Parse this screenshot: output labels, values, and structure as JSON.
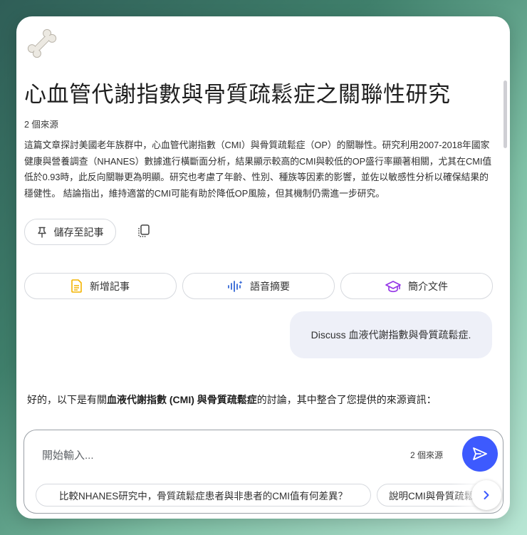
{
  "notebook": {
    "title": "心血管代謝指數與骨質疏鬆症之關聯性研究",
    "source_count": "2 個來源",
    "summary": "這篇文章探討美國老年族群中，心血管代謝指數（CMI）與骨質疏鬆症（OP）的關聯性。研究利用2007-2018年國家健康與營養調查（NHANES）數據進行橫斷面分析，結果顯示較高的CMI與較低的OP盛行率顯著相關，尤其在CMI值低於0.93時，此反向關聯更為明顯。研究也考慮了年齡、性別、種族等因素的影響，並佐以敏感性分析以確保結果的穩健性。 結論指出，維持適當的CMI可能有助於降低OP風險，但其機制仍需進一步研究。"
  },
  "actions": {
    "save_label": "儲存至記事",
    "add_note_label": "新增記事",
    "audio_summary_label": "語音摘要",
    "briefing_doc_label": "簡介文件"
  },
  "chat": {
    "user_message": "Discuss 血液代謝指數與骨質疏鬆症.",
    "reply_prefix": "好的，以下是有關",
    "reply_bold": "血液代謝指數 (CMI) 與骨質疏鬆症",
    "reply_suffix": "的討論，其中整合了您提供的來源資訊："
  },
  "composer": {
    "placeholder": "開始輸入...",
    "source_count": "2 個來源",
    "suggestions": [
      "比較NHANES研究中，骨質疏鬆症患者與非患者的CMI值有何差異？",
      "說明CMI與骨質疏鬆"
    ]
  },
  "icons": {
    "logo": "bone-icon",
    "save": "pin-icon",
    "copy": "copy-icon",
    "add_note": "note-icon",
    "audio": "waveform-icon",
    "briefing": "graduation-cap-icon",
    "send": "send-icon",
    "next": "chevron-right-icon"
  },
  "colors": {
    "accent": "#3d5afe",
    "note_icon": "#f4b400",
    "audio_icon": "#3367d6",
    "briefing_icon": "#9334e6",
    "user_bubble": "#eef0f8"
  }
}
